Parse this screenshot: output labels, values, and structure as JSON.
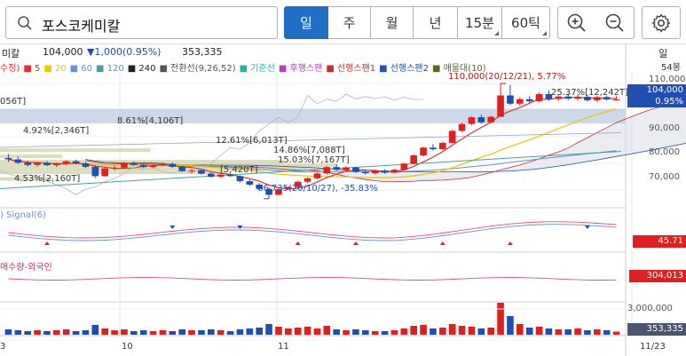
{
  "search": {
    "stock_name": "포스코케미칼"
  },
  "periods": [
    {
      "label": "일",
      "active": true
    },
    {
      "label": "주",
      "active": false
    },
    {
      "label": "월",
      "active": false
    },
    {
      "label": "년",
      "active": false
    },
    {
      "label": "15분",
      "active": false
    },
    {
      "label": "60틱",
      "active": false
    }
  ],
  "tools": {
    "zoom_in": "zoom-in-icon",
    "zoom_out": "zoom-out-icon",
    "settings": "gear-icon"
  },
  "info": {
    "name_partial": "미칼",
    "price": "104,000",
    "change": "▼1,000(0.95%)",
    "volume": "353,335",
    "period_label": "일"
  },
  "legend": [
    {
      "text": "수정)",
      "color": "#d33"
    },
    {
      "text": "■ 5",
      "color": "#e03030"
    },
    {
      "text": "■ 20",
      "color": "#e8c800"
    },
    {
      "text": "■ 60",
      "color": "#6a8fd0"
    },
    {
      "text": "■ 120",
      "color": "#4aa0a0"
    },
    {
      "text": "■ 240",
      "color": "#222"
    },
    {
      "text": "■ 전환선(9,26,52)",
      "color": "#555"
    },
    {
      "text": "■ 기준선",
      "color": "#2ab0a0"
    },
    {
      "text": "■ 후행스팬",
      "color": "#b040c0"
    },
    {
      "text": "■ 선행스팬1",
      "color": "#c03030"
    },
    {
      "text": "■ 선행스팬2",
      "color": "#2050b0"
    },
    {
      "text": "■ 매물대(10)",
      "color": "#5a6a20"
    }
  ],
  "annotations": {
    "high": "110,000(20/12/21), 5.77%",
    "low": "66,735(20/10/27), -35.83%",
    "bands": [
      "056T]",
      "8.61%[4,106T]",
      "4.92%[2,346T]",
      "12.61%[6,013T]",
      "14.86%[7,088T]",
      "15.03%[7,167T]",
      "[5,420T]",
      "4.53%[2,160T]",
      "25.37%[12,242T]"
    ],
    "macd": "Signal(6)",
    "investor": "매수량-외국인"
  },
  "price_axis": {
    "unit": "54봉",
    "ticks": [
      "110,000",
      "100,000",
      "90,000",
      "80,000",
      "70,000"
    ],
    "current": "104,000",
    "current_pct": "0.95%"
  },
  "indicator_values": {
    "macd": "45.71",
    "investor": "304,013",
    "volume_tick": "3,000,000",
    "volume_current": "353,335"
  },
  "date_axis": [
    "3",
    "10",
    "11",
    "11/23"
  ],
  "colors": {
    "up": "#e02020",
    "down": "#1f4fb0",
    "accent": "#1f6fc7"
  },
  "chart_data": {
    "type": "candlestick",
    "y_unit": "KRW",
    "ylim": [
      64000,
      114000
    ],
    "candles": [
      [
        82000,
        83500,
        80500,
        81500
      ],
      [
        81500,
        82500,
        79800,
        80200
      ],
      [
        80200,
        81000,
        78900,
        79400
      ],
      [
        79400,
        80600,
        78800,
        80100
      ],
      [
        80100,
        80900,
        79000,
        79300
      ],
      [
        79300,
        80400,
        78600,
        79900
      ],
      [
        79900,
        81200,
        79300,
        80800
      ],
      [
        80800,
        81400,
        79700,
        80000
      ],
      [
        80000,
        80500,
        78200,
        78700
      ],
      [
        78700,
        79300,
        74500,
        75200
      ],
      [
        75200,
        78400,
        75000,
        78100
      ],
      [
        78100,
        79200,
        77300,
        78400
      ],
      [
        78400,
        80500,
        78000,
        80200
      ],
      [
        80200,
        80700,
        79100,
        79400
      ],
      [
        79400,
        79800,
        78200,
        78600
      ],
      [
        78600,
        79600,
        78100,
        79200
      ],
      [
        79200,
        80200,
        78900,
        79800
      ],
      [
        79800,
        80300,
        78300,
        78700
      ],
      [
        78700,
        79200,
        76800,
        77100
      ],
      [
        77100,
        77900,
        76200,
        77400
      ],
      [
        77400,
        77900,
        75800,
        76100
      ],
      [
        76100,
        76600,
        74600,
        75000
      ],
      [
        75000,
        76200,
        74500,
        75800
      ],
      [
        75800,
        76300,
        74900,
        75200
      ],
      [
        75200,
        75500,
        72800,
        73300
      ],
      [
        73300,
        74000,
        71500,
        72000
      ],
      [
        72000,
        72600,
        69800,
        70400
      ],
      [
        70400,
        71000,
        66735,
        68200
      ],
      [
        68200,
        70800,
        68000,
        70300
      ],
      [
        70300,
        71400,
        69900,
        71100
      ],
      [
        71100,
        73500,
        70800,
        73100
      ],
      [
        73100,
        74800,
        72600,
        74400
      ],
      [
        74400,
        76500,
        74000,
        76200
      ],
      [
        76200,
        78900,
        75800,
        78600
      ],
      [
        78600,
        79600,
        77200,
        77600
      ],
      [
        77600,
        78900,
        77100,
        78500
      ],
      [
        78500,
        78700,
        76400,
        76800
      ],
      [
        76800,
        77400,
        75800,
        76300
      ],
      [
        76300,
        77600,
        75900,
        77300
      ],
      [
        77300,
        77800,
        76100,
        76500
      ],
      [
        76500,
        77900,
        76300,
        77600
      ],
      [
        77600,
        80200,
        77300,
        79900
      ],
      [
        79900,
        83300,
        79600,
        83000
      ],
      [
        83000,
        86200,
        82600,
        85900
      ],
      [
        85900,
        87200,
        84800,
        85300
      ],
      [
        85300,
        88100,
        85000,
        87700
      ],
      [
        87700,
        92600,
        87500,
        92200
      ],
      [
        92200,
        95300,
        91800,
        94800
      ],
      [
        94800,
        97600,
        94300,
        97300
      ],
      [
        97300,
        98200,
        94900,
        95400
      ],
      [
        95400,
        97800,
        95200,
        97500
      ],
      [
        97500,
        110000,
        97400,
        105500
      ],
      [
        105500,
        109500,
        101800,
        102400
      ],
      [
        102400,
        104800,
        101600,
        104100
      ],
      [
        104100,
        105200,
        102800,
        103300
      ],
      [
        103300,
        106600,
        102900,
        106000
      ],
      [
        106000,
        107400,
        103500,
        104200
      ],
      [
        104200,
        105600,
        103400,
        105100
      ],
      [
        105100,
        106200,
        103800,
        104300
      ],
      [
        104300,
        105900,
        103600,
        105000
      ],
      [
        105000,
        105800,
        103200,
        103700
      ],
      [
        103700,
        105300,
        103100,
        104900
      ],
      [
        104900,
        105500,
        103500,
        104000
      ],
      [
        104000,
        105200,
        103600,
        104000
      ]
    ],
    "volumes": [
      0.6,
      0.5,
      0.4,
      0.5,
      0.4,
      0.5,
      0.6,
      0.4,
      0.5,
      1.1,
      0.7,
      0.5,
      0.6,
      0.4,
      0.5,
      0.4,
      0.5,
      0.4,
      0.6,
      0.5,
      0.5,
      0.6,
      0.5,
      0.4,
      0.6,
      0.7,
      0.8,
      1.2,
      0.9,
      0.7,
      0.8,
      0.9,
      0.7,
      1.0,
      0.6,
      0.5,
      0.6,
      0.5,
      0.4,
      0.4,
      0.5,
      0.7,
      1.0,
      1.1,
      0.7,
      0.8,
      1.2,
      1.0,
      0.9,
      0.7,
      0.8,
      3.6,
      2.1,
      1.2,
      0.8,
      0.9,
      0.7,
      0.6,
      0.6,
      0.7,
      0.5,
      0.6,
      0.5,
      0.35
    ],
    "volume_unit": "millions of shares"
  }
}
